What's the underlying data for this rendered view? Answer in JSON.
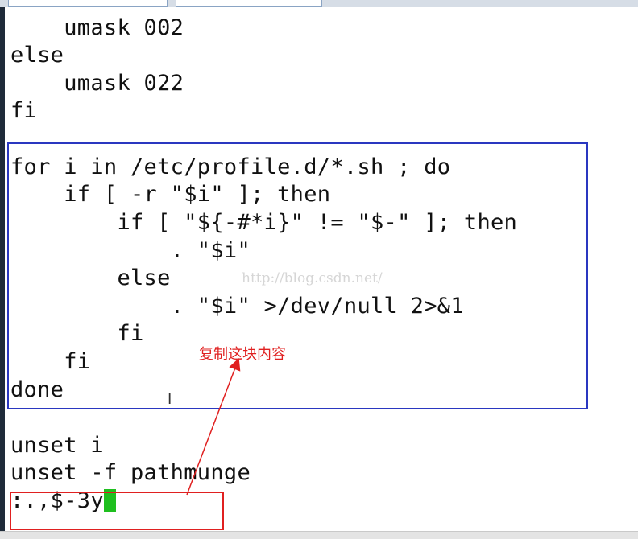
{
  "editor": {
    "lines": [
      "    umask 002",
      "else",
      "    umask 022",
      "fi",
      "",
      "for i in /etc/profile.d/*.sh ; do",
      "    if [ -r \"$i\" ]; then",
      "        if [ \"${-#*i}\" != \"$-\" ]; then",
      "            . \"$i\"",
      "        else",
      "            . \"$i\" >/dev/null 2>&1",
      "        fi",
      "    fi",
      "done",
      "",
      "unset i",
      "unset -f pathmunge"
    ],
    "command_line": ":.,$-3y"
  },
  "watermark": "http://blog.csdn.net/",
  "annotation": "复制这块内容",
  "colors": {
    "highlight_box": "#2a37c0",
    "command_box": "#e02020",
    "annotation": "#e02020",
    "cursor": "#1fbf1f"
  }
}
